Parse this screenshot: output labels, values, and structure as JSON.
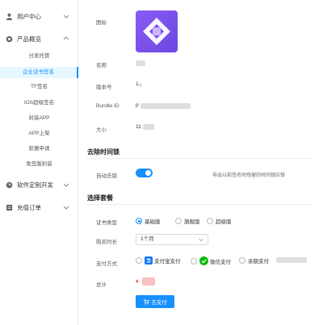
{
  "sidebar": {
    "user_center": "用户中心",
    "product_overview": "产品概览",
    "sub_items": [
      "分发托管",
      "企业证书签名",
      "TF签名",
      "IOS超级签名",
      "封装APP",
      "APP上架",
      "软著申请",
      "免签版封装"
    ],
    "active_index": 1,
    "custom_dev": "软件定制开发",
    "recharge_order": "充值订单"
  },
  "app_info": {
    "icon_label": "图标",
    "name_label": "名称",
    "version_label": "版本号",
    "version_value": "1",
    "bundle_label": "Bundle ID",
    "bundle_value": "p",
    "size_label": "大小",
    "size_value": "11"
  },
  "lock": {
    "section_title": "去除时间锁",
    "auto_label": "自动去锁",
    "auto_enabled": true,
    "hint": "导出以前签名时残留的时间锁应锁"
  },
  "plan": {
    "section_title": "选择套餐",
    "cert_type_label": "证书类型",
    "cert_types": [
      "基础版",
      "旗舰版",
      "超级版"
    ],
    "cert_selected": 0,
    "duration_label": "购买时长",
    "duration_value": "1个月",
    "pay_label": "支付方式",
    "pay_methods": [
      "支付宝支付",
      "微信支付",
      "余额支付"
    ],
    "total_label": "总计",
    "total_prefix": "¥",
    "pay_button": "去支付"
  },
  "colors": {
    "primary": "#1890ff",
    "alipay": "#1677ff",
    "wechat": "#09bb07",
    "icon_purple": "#7c52ef"
  }
}
